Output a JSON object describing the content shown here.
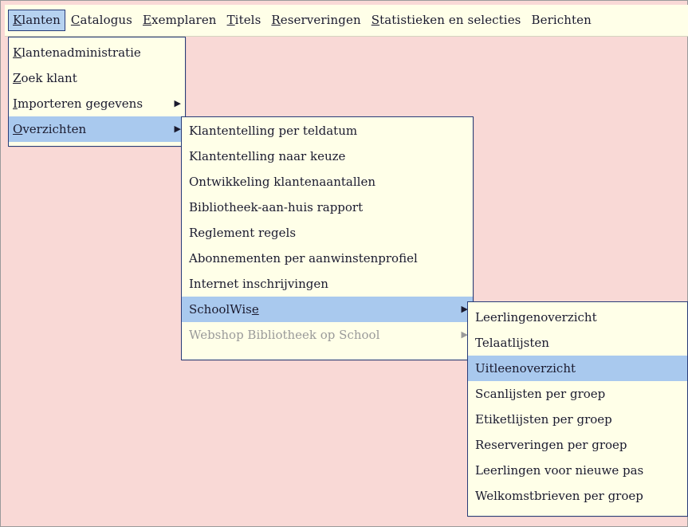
{
  "colors": {
    "background": "#f9d9d6",
    "menu_bg": "#ffffe8",
    "highlight": "#a9c9ee",
    "border": "#283c78",
    "disabled_text": "#9a9a9a"
  },
  "menubar": {
    "items": [
      {
        "prefix": "",
        "key": "K",
        "rest": "lanten"
      },
      {
        "prefix": "",
        "key": "C",
        "rest": "atalogus"
      },
      {
        "prefix": "",
        "key": "E",
        "rest": "xemplaren"
      },
      {
        "prefix": "",
        "key": "T",
        "rest": "itels"
      },
      {
        "prefix": "",
        "key": "R",
        "rest": "eserveringen"
      },
      {
        "prefix": "",
        "key": "S",
        "rest": "tatistieken en selecties"
      },
      {
        "prefix": "",
        "key": "",
        "rest": "Berichten"
      }
    ]
  },
  "klanten_menu": {
    "items": [
      {
        "key": "K",
        "rest": "lantenadministratie"
      },
      {
        "key": "Z",
        "rest": "oek klant"
      },
      {
        "key": "I",
        "rest": "mporteren gegevens"
      },
      {
        "key": "O",
        "rest": "verzichten"
      }
    ]
  },
  "overzichten_menu": {
    "items": [
      "Klantentelling per teldatum",
      "Klantentelling naar keuze",
      "Ontwikkeling klantenaantallen",
      "Bibliotheek-aan-huis rapport",
      "Reglement regels",
      "Abonnementen per aanwinstenprofiel",
      "Internet inschrijvingen",
      {
        "pre": "SchoolWis",
        "key": "e"
      },
      "Webshop Bibliotheek op School"
    ]
  },
  "schoolwise_menu": {
    "items": [
      "Leerlingenoverzicht",
      "Telaatlijsten",
      "Uitleenoverzicht",
      "Scanlijsten per groep",
      "Etiketlijsten per groep",
      "Reserveringen per groep",
      "Leerlingen voor nieuwe pas",
      "Welkomstbrieven per groep"
    ]
  }
}
